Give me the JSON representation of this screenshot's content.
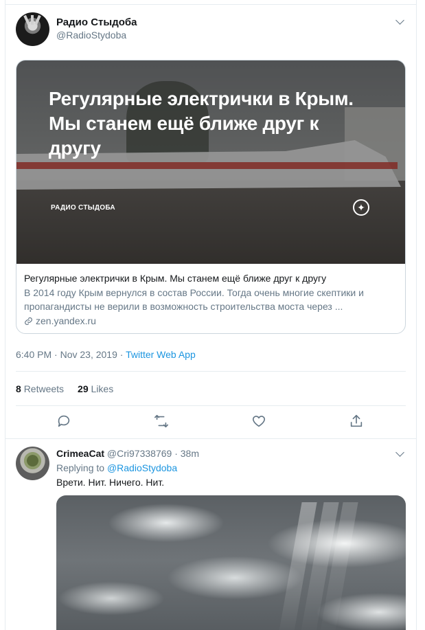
{
  "tweet": {
    "author_name": "Радио Стыдоба",
    "author_handle": "@RadioStydoba",
    "card": {
      "image_headline": "Регулярные электрички в Крым. Мы станем ещё ближе друг к другу",
      "image_brand": "РАДИО СТЫДОБА",
      "title": "Регулярные электрички в Крым. Мы станем ещё ближе друг к другу",
      "description": "В 2014 году Крым вернулся в состав России. Тогда очень многие скептики и пропагандисты не верили в возможность строительства моста через ...",
      "domain": "zen.yandex.ru"
    },
    "timestamp": "6:40 PM · Nov 23, 2019 · ",
    "source_app": "Twitter Web App",
    "retweets_count": "8",
    "retweets_label": "Retweets",
    "likes_count": "29",
    "likes_label": "Likes"
  },
  "reply": {
    "author_name": "CrimeaCat",
    "author_handle_time": "@Cri97338769 · 38m",
    "replying_prefix": "Replying to ",
    "replying_mention": "@RadioStydoba",
    "text": "Врети. Нит. Ничего. Нит."
  },
  "icons": {
    "reply": "reply-icon",
    "retweet": "retweet-icon",
    "like": "heart-icon",
    "share": "share-icon",
    "link": "link-icon",
    "zen": "zen-sparkle-icon",
    "menu": "chevron-down-icon"
  },
  "colors": {
    "link_blue": "#1b95e0",
    "secondary_text": "#657786",
    "border": "#e6ecf0"
  }
}
